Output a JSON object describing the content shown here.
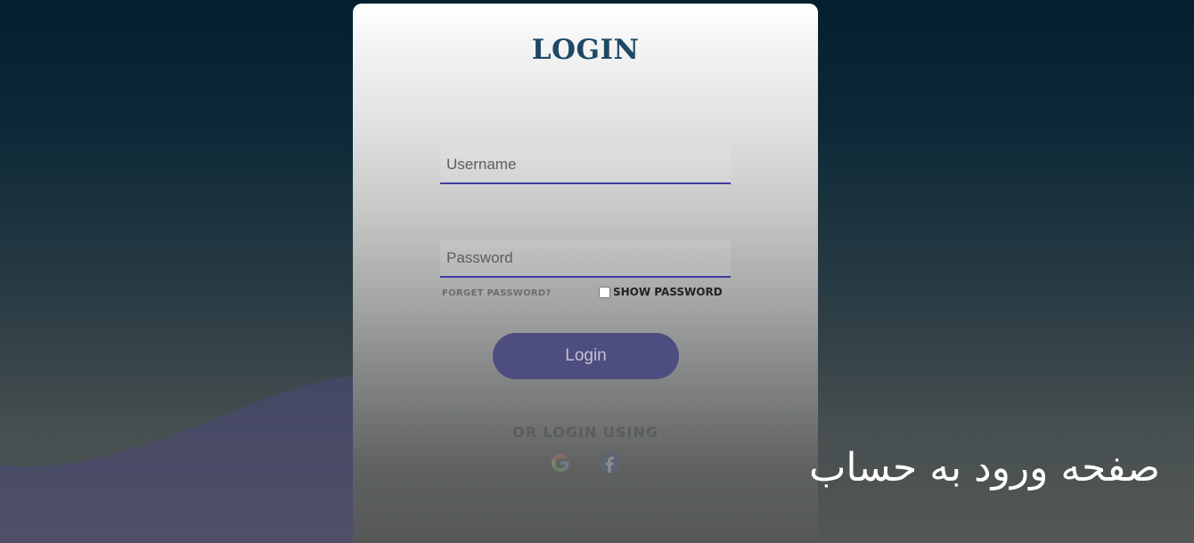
{
  "login_card": {
    "title": "LOGIN",
    "username_placeholder": "Username",
    "password_placeholder": "Password",
    "forget_password_label": "FORGET PASSWORD?",
    "show_password_label": "SHOW PASSWORD",
    "show_password_checked": false,
    "login_button_label": "Login",
    "or_login_using": "OR LOGIN USING",
    "social_icons": [
      "google-icon",
      "facebook-icon"
    ]
  },
  "caption": "صفحه ورود به حساب",
  "colors": {
    "title": "#1d4866",
    "button": "#4e4d80",
    "input_underline": "#3d3aa0",
    "wave": "#4a4878"
  }
}
